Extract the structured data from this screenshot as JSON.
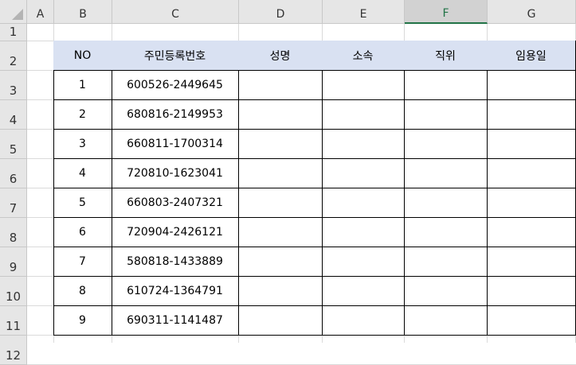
{
  "columns": [
    "A",
    "B",
    "C",
    "D",
    "E",
    "F",
    "G"
  ],
  "selected_column": "F",
  "rows": [
    "1",
    "2",
    "3",
    "4",
    "5",
    "6",
    "7",
    "8",
    "9",
    "10",
    "11",
    "12"
  ],
  "table": {
    "headers": [
      "NO",
      "주민등록번호",
      "성명",
      "소속",
      "직위",
      "임용일"
    ],
    "records": [
      [
        "1",
        "600526-2449645"
      ],
      [
        "2",
        "680816-2149953"
      ],
      [
        "3",
        "660811-1700314"
      ],
      [
        "4",
        "720810-1623041"
      ],
      [
        "5",
        "660803-2407321"
      ],
      [
        "6",
        "720904-2426121"
      ],
      [
        "7",
        "580818-1433889"
      ],
      [
        "8",
        "610724-1364791"
      ],
      [
        "9",
        "690311-1141487"
      ]
    ]
  },
  "colors": {
    "header_fill": "#d9e1f2",
    "selected_accent": "#217346"
  }
}
